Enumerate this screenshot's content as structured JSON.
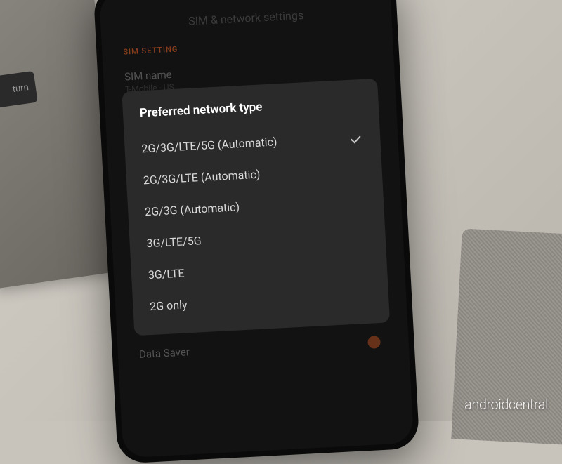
{
  "laptop": {
    "key_label": "turn"
  },
  "watermark": "androidcentral",
  "phone": {
    "screen_title": "SIM & network settings",
    "section_label": "SIM SETTING",
    "sim_name": {
      "label": "SIM name",
      "value": "T-Mobile - US"
    },
    "preferred_type_row": {
      "label": "Preferred network type",
      "value": "2G/3G/LTE/5G (Automatic)"
    },
    "data_saver": {
      "label": "Data Saver"
    }
  },
  "dialog": {
    "title": "Preferred network type",
    "selected_index": 0,
    "options": [
      "2G/3G/LTE/5G (Automatic)",
      "2G/3G/LTE (Automatic)",
      "2G/3G (Automatic)",
      "3G/LTE/5G",
      "3G/LTE",
      "2G only"
    ]
  }
}
